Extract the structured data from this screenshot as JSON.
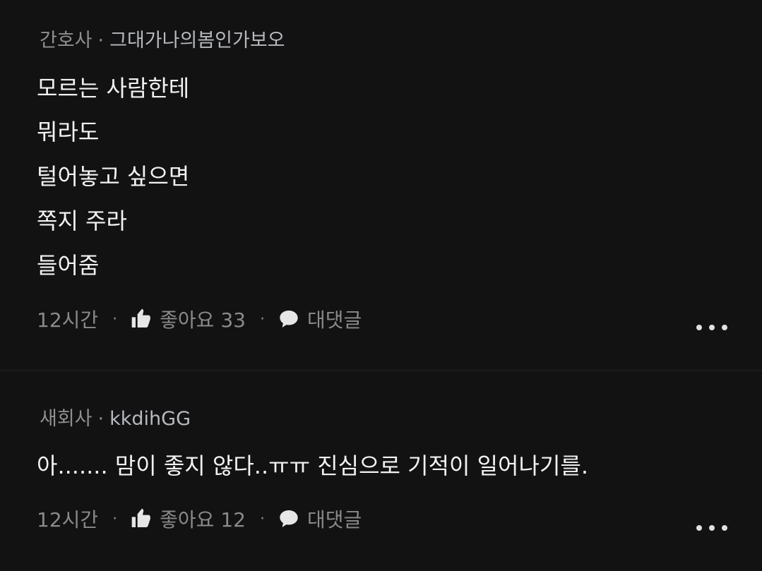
{
  "comments": [
    {
      "badge": "간호사",
      "nickname": "그대가나의봄인가보오",
      "lines": [
        "모르는 사람한테",
        "뭐라도",
        "털어놓고 싶으면",
        "쪽지 주라",
        "들어줌"
      ],
      "time": "12시간",
      "like_label": "좋아요 33",
      "reply_label": "대댓글",
      "like_icon": "thumbs-up-icon",
      "reply_icon": "speech-bubble-icon",
      "more_icon": "more-dots-icon"
    },
    {
      "badge": "새회사",
      "nickname": "kkdihGG",
      "lines": [
        "아....... 맘이 좋지 않다..ㅠㅠ 진심으로 기적이 일어나기를."
      ],
      "time": "12시간",
      "like_label": "좋아요 12",
      "reply_label": "대댓글",
      "like_icon": "thumbs-up-icon",
      "reply_icon": "speech-bubble-icon",
      "more_icon": "more-dots-icon"
    }
  ],
  "meta_separator": "·",
  "colors": {
    "background": "#121212",
    "text_primary": "#f2f2f2",
    "text_secondary": "#8f8f8f",
    "nickname": "#b7b9c0"
  }
}
